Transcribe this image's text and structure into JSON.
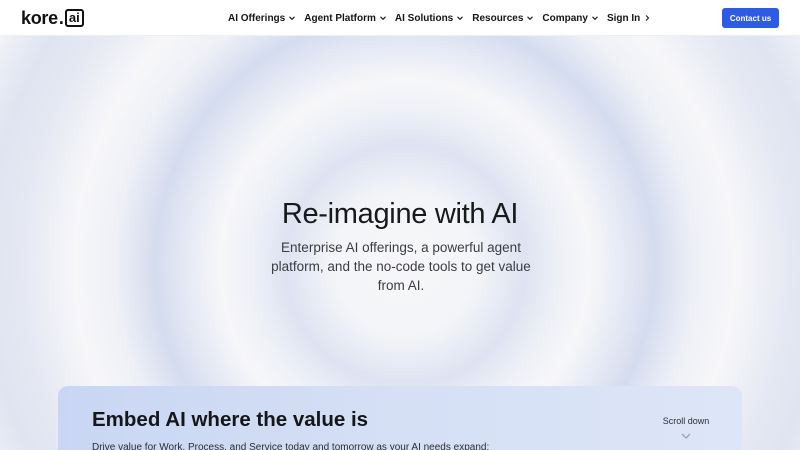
{
  "nav": {
    "logo": {
      "kore": "kore",
      "dot": ".",
      "ai": "ai"
    },
    "items": [
      {
        "label": "AI Offerings",
        "icon": "chevron-down-icon"
      },
      {
        "label": "Agent Platform",
        "icon": "chevron-down-icon"
      },
      {
        "label": "AI Solutions",
        "icon": "chevron-down-icon"
      },
      {
        "label": "Resources",
        "icon": "chevron-down-icon"
      },
      {
        "label": "Company",
        "icon": "chevron-down-icon"
      },
      {
        "label": "Sign In",
        "icon": "chevron-right-icon"
      }
    ],
    "contact_label": "Contact us"
  },
  "hero": {
    "title": "Re-imagine with AI",
    "subtitle": "Enterprise AI offerings, a powerful agent platform, and the no-code tools to get value from AI."
  },
  "embed": {
    "title": "Embed AI where the value is",
    "subtitle": "Drive value for Work, Process, and Service today and tomorrow as your AI needs expand:",
    "scroll_label": "Scroll down"
  },
  "colors": {
    "accent": "#2d5be3",
    "card": "#d4dff5",
    "text": "#18191c"
  }
}
